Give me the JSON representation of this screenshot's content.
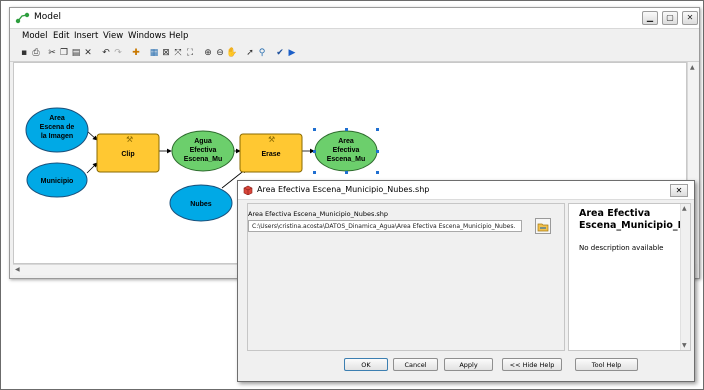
{
  "model_window": {
    "title": "Model",
    "menu": [
      "Model",
      "Edit",
      "Insert",
      "View",
      "Windows",
      "Help"
    ],
    "window_buttons": [
      "▁",
      "▢",
      "✕"
    ]
  },
  "diagram": {
    "inputs": [
      {
        "lines": [
          "Area",
          "Escena de",
          "la Imagen"
        ]
      },
      {
        "lines": [
          "Municipio"
        ]
      },
      {
        "lines": [
          "Nubes"
        ]
      }
    ],
    "tools": [
      {
        "label": "Clip"
      },
      {
        "label": "Erase"
      }
    ],
    "outputs": [
      {
        "lines": [
          "Agua",
          "Efectiva",
          "Escena_Mu"
        ]
      },
      {
        "lines": [
          "Area",
          "Efectiva",
          "Escena_Mu"
        ]
      }
    ],
    "colors": {
      "input": "#00a9e6",
      "tool": "#ffc832",
      "output": "#6ccf6c"
    }
  },
  "dialog": {
    "title": "Area Efectiva Escena_Municipio_Nubes.shp",
    "field_label": "Area Efectiva Escena_Municipio_Nubes.shp",
    "field_value": "C:\\Users\\cristina.acosta\\DATOS_Dinamica_Agua\\Area Efectiva Escena_Municipio_Nubes.",
    "help_title_1": "Area Efectiva",
    "help_title_2": "Escena_Municipio_Nu",
    "help_desc": "No description available",
    "buttons": {
      "ok": "OK",
      "cancel": "Cancel",
      "apply": "Apply",
      "hide_help": "<< Hide Help",
      "tool_help": "Tool Help"
    }
  }
}
